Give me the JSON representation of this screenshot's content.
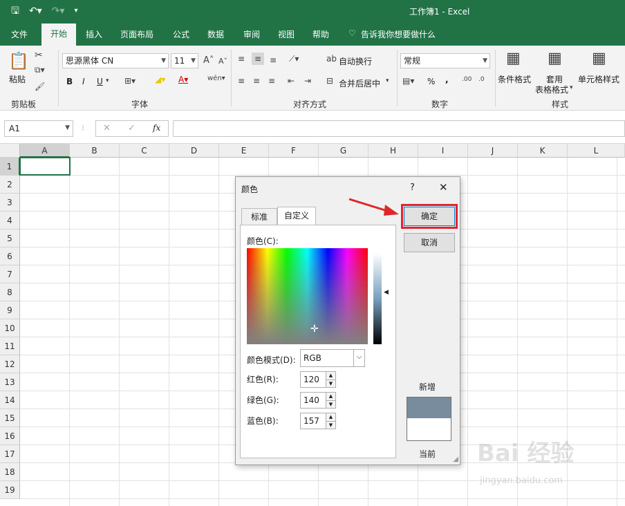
{
  "window_title": "工作簿1  -  Excel",
  "menu": [
    "文件",
    "开始",
    "插入",
    "页面布局",
    "公式",
    "数据",
    "审阅",
    "视图",
    "帮助"
  ],
  "menu_active": "开始",
  "tell_me": "告诉我你想要做什么",
  "ribbon": {
    "paste": "粘贴",
    "clipboard": "剪贴板",
    "font_name": "思源黑体 CN",
    "font_size": "11",
    "font_group": "字体",
    "wrap_text": "自动换行",
    "merge_center": "合并后居中",
    "align_group": "对齐方式",
    "number_format": "常规",
    "number_group": "数字",
    "cond_format": "条件格式",
    "table_format_1": "套用",
    "table_format_2": "表格格式",
    "cell_style": "单元格样式",
    "styles_group": "样式",
    "bold": "B",
    "italic": "I",
    "underline": "U",
    "percent": "%",
    "comma": ","
  },
  "name_box": "A1",
  "fx": "fx",
  "columns": [
    "A",
    "B",
    "C",
    "D",
    "E",
    "F",
    "G",
    "H",
    "I",
    "J",
    "K",
    "L"
  ],
  "rows": [
    "1",
    "2",
    "3",
    "4",
    "5",
    "6",
    "7",
    "8",
    "9",
    "10",
    "11",
    "12",
    "13",
    "14",
    "15",
    "16",
    "17",
    "18",
    "19"
  ],
  "dialog": {
    "title": "颜色",
    "help": "?",
    "close": "✕",
    "tab_standard": "标准",
    "tab_custom": "自定义",
    "ok": "确定",
    "cancel": "取消",
    "colors_label": "颜色(C):",
    "mode_label": "颜色模式(D):",
    "mode_value": "RGB",
    "red_label": "红色(R):",
    "green_label": "绿色(G):",
    "blue_label": "蓝色(B):",
    "red": "120",
    "green": "140",
    "blue": "157",
    "new_label": "新增",
    "current_label": "当前",
    "new_color": "#788c9d"
  },
  "watermark": "Bai 经验",
  "watermark_url": "jingyan.baidu.com"
}
